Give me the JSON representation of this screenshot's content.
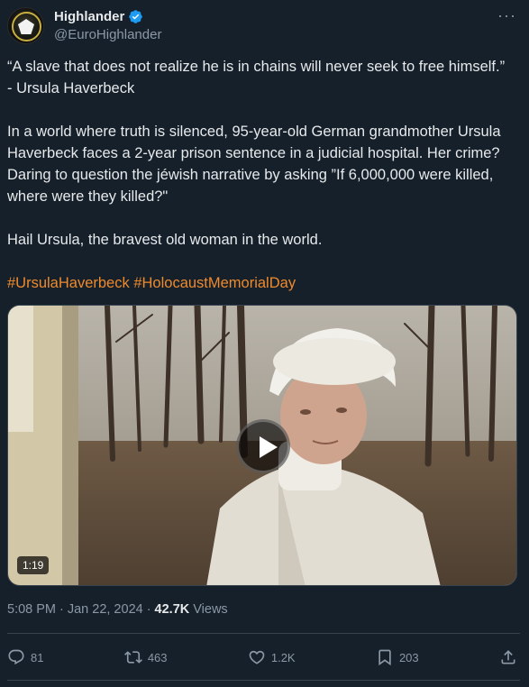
{
  "author": {
    "display_name": "Highlander",
    "handle": "@EuroHighlander",
    "avatar_icon": "avatar-emblem-icon",
    "verified_color": "#1d9bf0"
  },
  "tweet": {
    "paragraphs": [
      "“A slave that does not realize he is in chains will never seek to free himself.” - Ursula Haverbeck",
      "In a world where truth is silenced, 95-year-old German grandmother Ursula Haverbeck faces a 2-year prison sentence in a judicial hospital. Her crime? Daring to question the jéwish narrative by asking ”If 6,000,000 were killed, where were they killed?\"",
      "Hail Ursula, the bravest old woman in the world."
    ],
    "hashtags": [
      "#UrsulaHaverbeck",
      "#HolocaustMemorialDay"
    ]
  },
  "media": {
    "type": "video",
    "duration": "1:19"
  },
  "meta": {
    "time": "5:08 PM",
    "separator": "·",
    "date": "Jan 22, 2024",
    "views_count": "42.7K",
    "views_label": "Views"
  },
  "actions": {
    "replies": "81",
    "reposts": "463",
    "likes": "1.2K",
    "bookmarks": "203"
  },
  "colors": {
    "background": "#15202b",
    "text": "#e7e9ea",
    "secondary": "#8b98a5",
    "hashtag": "#ef8a2c",
    "divider": "#38444d"
  }
}
